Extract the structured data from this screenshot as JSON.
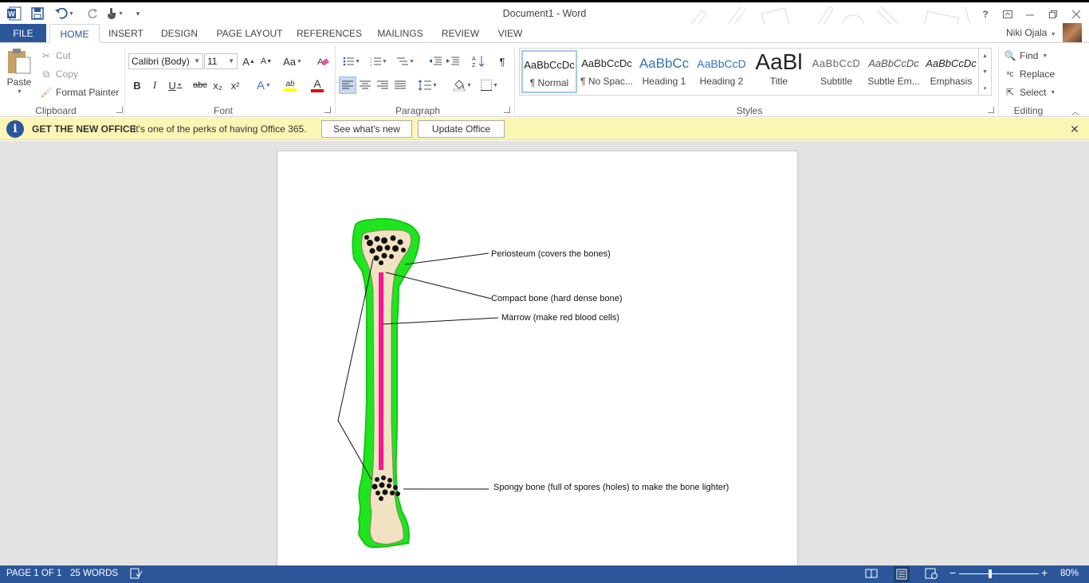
{
  "titlebar": {
    "title": "Document1 - Word",
    "qat_icons": [
      "word-logo-icon",
      "save-icon",
      "undo-icon",
      "redo-icon",
      "touch-mode-icon",
      "customize-qat-icon"
    ],
    "window_icons": [
      "help-icon",
      "ribbon-display-icon",
      "minimize-icon",
      "restore-icon",
      "close-icon"
    ]
  },
  "tabs": {
    "items": [
      "FILE",
      "HOME",
      "INSERT",
      "DESIGN",
      "PAGE LAYOUT",
      "REFERENCES",
      "MAILINGS",
      "REVIEW",
      "VIEW"
    ],
    "active": "HOME"
  },
  "user": {
    "name": "Niki Ojala"
  },
  "clipboard": {
    "paste": "Paste",
    "cut": "Cut",
    "copy": "Copy",
    "format_painter": "Format Painter",
    "label": "Clipboard"
  },
  "font": {
    "name": "Calibri (Body)",
    "size": "11",
    "change_case": "Aa",
    "label": "Font",
    "bold": "B",
    "italic": "I",
    "underline": "U",
    "strike": "abc",
    "subscript": "x₂",
    "superscript": "x²",
    "grow": "A",
    "shrink": "A",
    "text_effects": "A",
    "font_color": "A",
    "highlight": "ab"
  },
  "paragraph": {
    "label": "Paragraph",
    "show_marks": "¶"
  },
  "styles": {
    "label": "Styles",
    "items": [
      {
        "sample": "AaBbCcDc",
        "name": "¶ Normal"
      },
      {
        "sample": "AaBbCcDc",
        "name": "¶ No Spac..."
      },
      {
        "sample": "AaBbCc",
        "name": "Heading 1"
      },
      {
        "sample": "AaBbCcD",
        "name": "Heading 2"
      },
      {
        "sample": "AaBl",
        "name": "Title"
      },
      {
        "sample": "AaBbCcD",
        "name": "Subtitle"
      },
      {
        "sample": "AaBbCcDc",
        "name": "Subtle Em..."
      },
      {
        "sample": "AaBbCcDc",
        "name": "Emphasis"
      }
    ],
    "selected": "¶ Normal"
  },
  "editing": {
    "find": "Find",
    "replace": "Replace",
    "select": "Select",
    "label": "Editing"
  },
  "notice": {
    "title": "GET THE NEW OFFICE",
    "text": "It's one of the perks of having Office 365.",
    "btn_whats_new": "See what's new",
    "btn_update": "Update Office",
    "close": "✕"
  },
  "document": {
    "labels": [
      "Periosteum (covers the bones)",
      "Compact bone (hard dense bone)",
      "Marrow (make red blood cells)",
      "Spongy bone (full of spores (holes) to make the bone lighter)"
    ],
    "colors": {
      "periosteum": "#1ee61e",
      "compact": "#f0e2c2",
      "marrow": "#ff1493",
      "spongy": "#111111"
    }
  },
  "status": {
    "page": "PAGE 1 OF 1",
    "words": "25 WORDS",
    "zoom": "80%",
    "zoom_level": 0.8,
    "view_icons": [
      "read-mode-icon",
      "print-layout-icon",
      "web-layout-icon"
    ]
  },
  "colors": {
    "accent": "#2b579a",
    "notice_bg": "#fcf6b6"
  }
}
